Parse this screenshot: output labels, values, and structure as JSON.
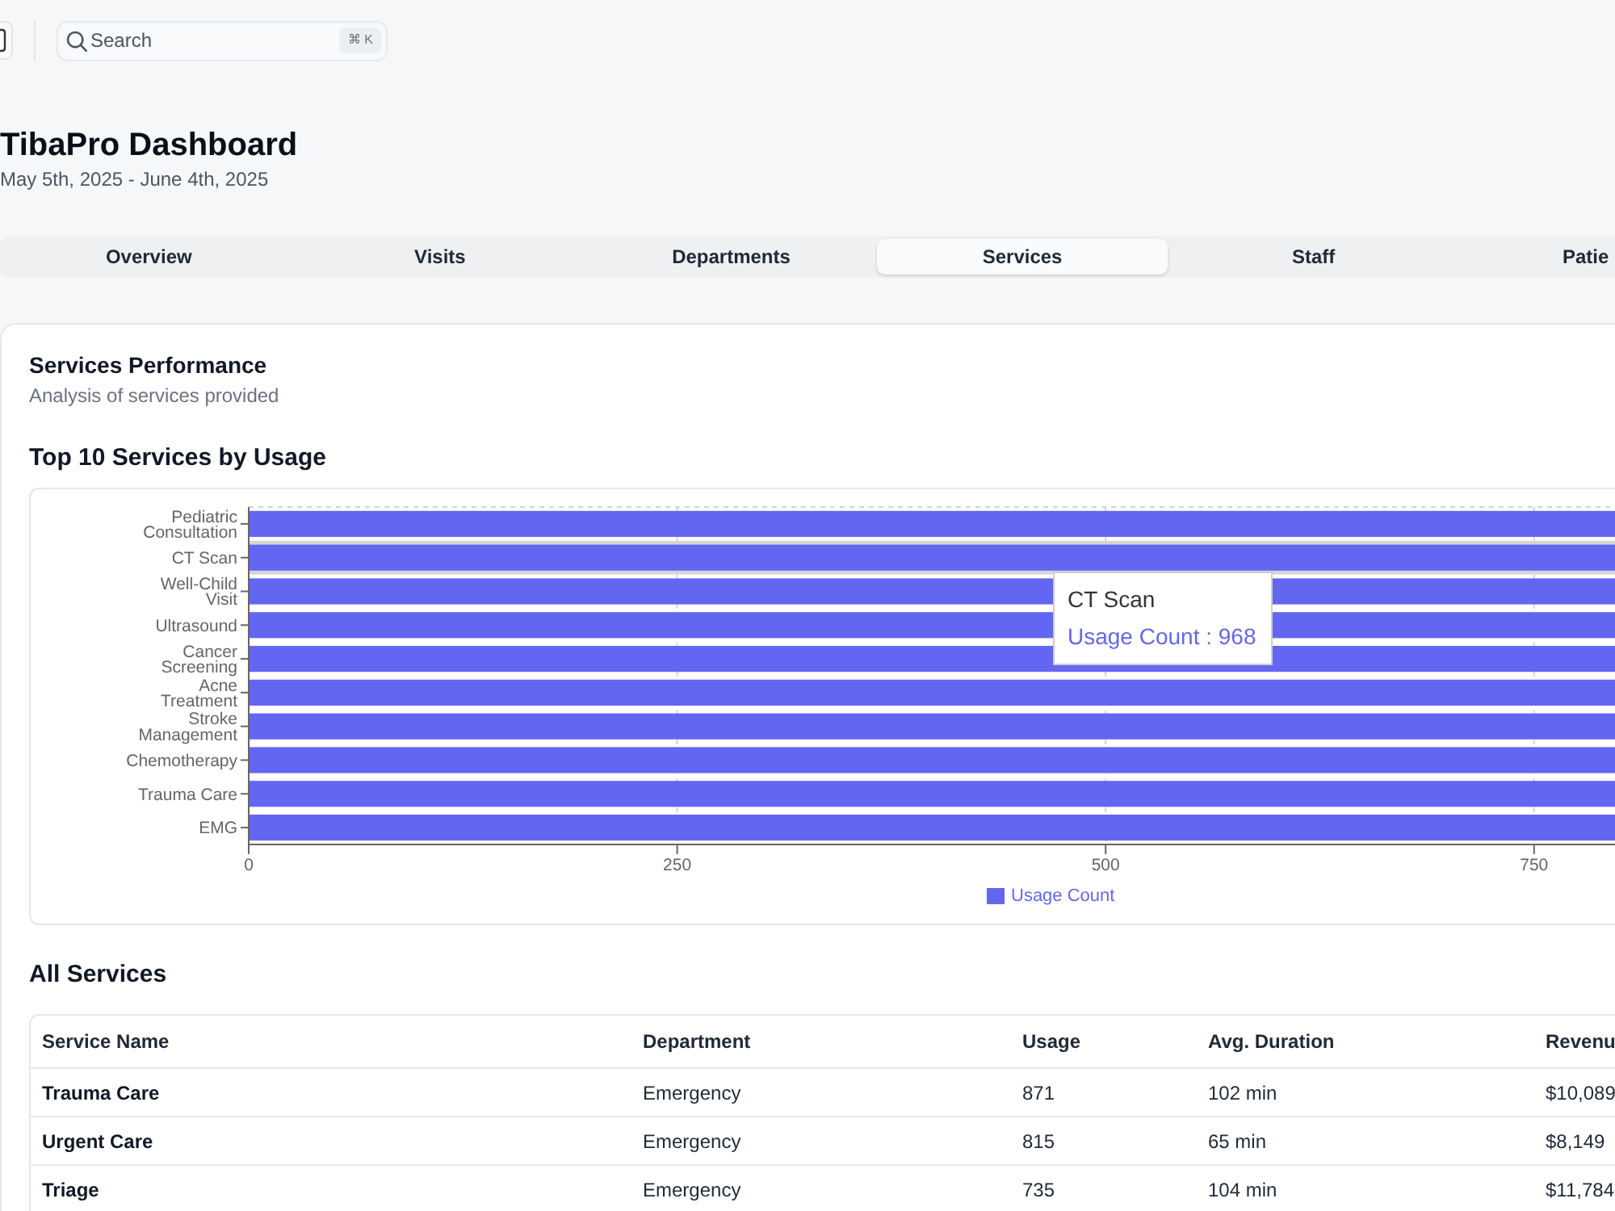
{
  "header": {
    "search": {
      "placeholder": "Search",
      "shortcut": "⌘ K"
    }
  },
  "page": {
    "title": "TibaPro Dashboard",
    "date_range": "May 5th, 2025 - June 4th, 2025"
  },
  "tabs": [
    {
      "label": "Overview",
      "selected": false
    },
    {
      "label": "Visits",
      "selected": false
    },
    {
      "label": "Departments",
      "selected": false
    },
    {
      "label": "Services",
      "selected": true
    },
    {
      "label": "Staff",
      "selected": false
    },
    {
      "label": "Patie",
      "selected": false
    }
  ],
  "panel": {
    "title": "Services Performance",
    "subtitle": "Analysis of services provided",
    "chart_section": {
      "title": "Top 10 Services by Usage",
      "bars": [
        {
          "label": "Pediatric Consultation",
          "hovered": false
        },
        {
          "label": "CT Scan",
          "hovered": true
        },
        {
          "label": "Well-Child Visit",
          "hovered": false
        },
        {
          "label": "Ultrasound",
          "hovered": false
        },
        {
          "label": "Cancer Screening",
          "hovered": false
        },
        {
          "label": "Acne Treatment",
          "hovered": false
        },
        {
          "label": "Stroke Management",
          "hovered": false
        },
        {
          "label": "Chemotherapy",
          "hovered": false
        },
        {
          "label": "Trauma Care",
          "hovered": false
        },
        {
          "label": "EMG",
          "hovered": false
        }
      ],
      "x_ticks": [
        "0",
        "250",
        "500",
        "750"
      ],
      "legend": "Usage Count",
      "tooltip": {
        "title": "CT Scan",
        "label": "Usage Count : 968"
      }
    },
    "table_section": {
      "title": "All Services",
      "columns": [
        "Service Name",
        "Department",
        "Usage",
        "Avg. Duration",
        "Revenu"
      ],
      "rows": [
        [
          "Trauma Care",
          "Emergency",
          "871",
          "102 min",
          "$10,089"
        ],
        [
          "Urgent Care",
          "Emergency",
          "815",
          "65 min",
          "$8,149"
        ],
        [
          "Triage",
          "Emergency",
          "735",
          "104 min",
          "$11,784"
        ]
      ]
    }
  }
}
